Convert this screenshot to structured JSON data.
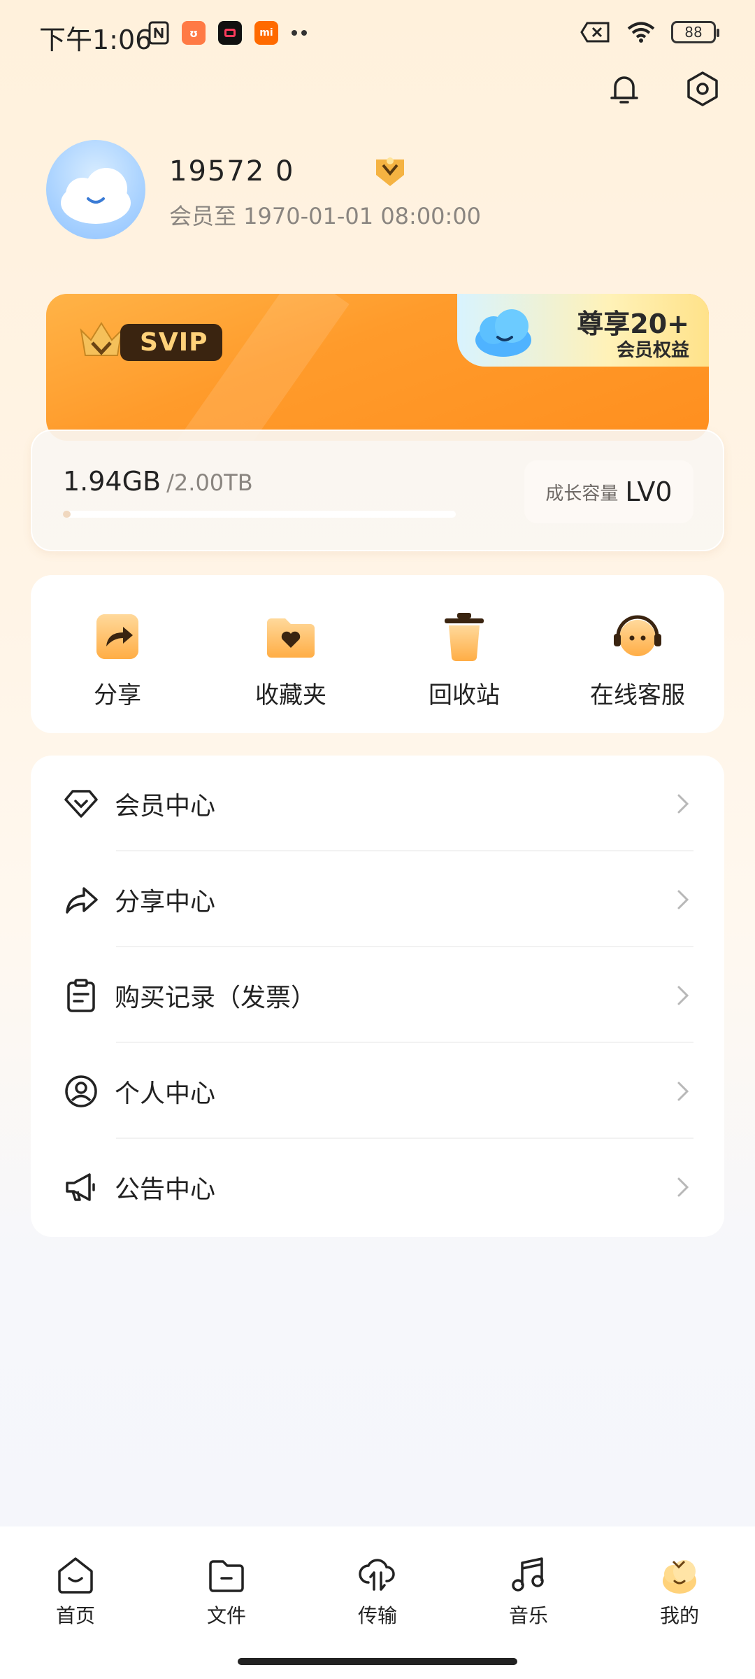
{
  "status_bar": {
    "time": "下午1:06",
    "battery": "88",
    "app_icons": [
      "nfc-icon",
      "app-icon-orange",
      "screen-record-icon",
      "mi-icon",
      "more-dots-icon"
    ],
    "right_icons": [
      "sim-off-icon",
      "wifi-icon",
      "battery-icon"
    ]
  },
  "top_actions": [
    "bell-icon",
    "settings-hexagon-icon"
  ],
  "profile": {
    "username": "19572   0",
    "member_until": "会员至 1970-01-01 08:00:00"
  },
  "svip_card": {
    "badge": "SVIP",
    "perk_title": "尊享20+",
    "perk_subtitle": "会员权益",
    "colors": {
      "card": "#ff9b2b",
      "pill_bg": "#3a2410",
      "pill_text": "#ffd27a"
    }
  },
  "storage": {
    "used": "1.94GB",
    "total": "/2.00TB",
    "used_fraction": 0.001,
    "growth_label": "成长容量",
    "growth_level": "LV0"
  },
  "quick_actions": [
    {
      "label": "分享",
      "icon": "share-arrow-icon"
    },
    {
      "label": "收藏夹",
      "icon": "favorites-folder-icon"
    },
    {
      "label": "回收站",
      "icon": "recycle-bin-icon"
    },
    {
      "label": "在线客服",
      "icon": "customer-service-icon"
    }
  ],
  "menu": [
    {
      "label": "会员中心",
      "icon": "diamond-icon"
    },
    {
      "label": "分享中心",
      "icon": "share-icon"
    },
    {
      "label": "购买记录（发票）",
      "icon": "clipboard-icon"
    },
    {
      "label": "个人中心",
      "icon": "user-circle-icon"
    },
    {
      "label": "公告中心",
      "icon": "megaphone-icon"
    }
  ],
  "bottom_nav": [
    {
      "label": "首页",
      "icon": "home-icon"
    },
    {
      "label": "文件",
      "icon": "folder-icon"
    },
    {
      "label": "传输",
      "icon": "cloud-transfer-icon"
    },
    {
      "label": "音乐",
      "icon": "music-note-icon"
    },
    {
      "label": "我的",
      "icon": "mascot-avatar-icon",
      "active": true
    }
  ]
}
